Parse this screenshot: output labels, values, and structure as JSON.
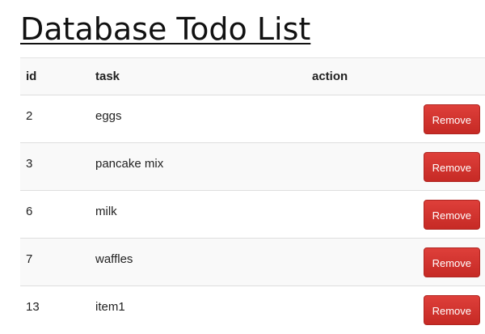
{
  "page": {
    "title": "Database Todo List"
  },
  "table": {
    "headers": {
      "id": "id",
      "task": "task",
      "action": "action"
    },
    "rows": [
      {
        "id": "2",
        "task": "eggs",
        "action_label": "Remove"
      },
      {
        "id": "3",
        "task": "pancake mix",
        "action_label": "Remove"
      },
      {
        "id": "6",
        "task": "milk",
        "action_label": "Remove"
      },
      {
        "id": "7",
        "task": "waffles",
        "action_label": "Remove"
      },
      {
        "id": "13",
        "task": "item1",
        "action_label": "Remove"
      }
    ]
  },
  "colors": {
    "remove_button": "#d9534f",
    "striped_row": "#f9f9f9"
  }
}
